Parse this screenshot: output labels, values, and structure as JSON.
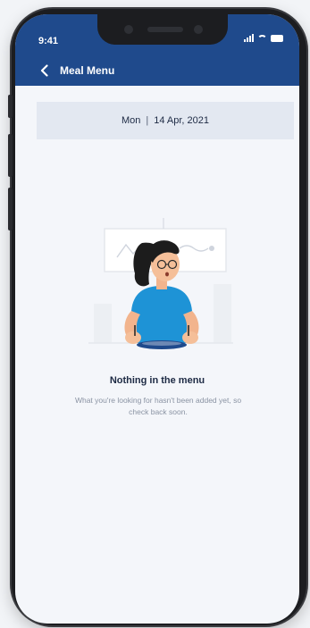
{
  "status": {
    "time": "9:41"
  },
  "nav": {
    "title": "Meal Menu"
  },
  "date_bar": {
    "day": "Mon",
    "separator": "|",
    "date": "14 Apr, 2021"
  },
  "empty_state": {
    "title": "Nothing in the menu",
    "description": "What you're looking for hasn't been added yet, so check back soon."
  },
  "colors": {
    "header": "#1f4a8c",
    "screen_bg": "#f4f6fa",
    "date_bar_bg": "#e3e8f1",
    "shirt": "#1e93d6",
    "plate": "#1f4a8c"
  },
  "icons": {
    "back": "chevron-left-icon",
    "signal": "signal-icon",
    "wifi": "wifi-icon",
    "battery": "battery-icon"
  }
}
